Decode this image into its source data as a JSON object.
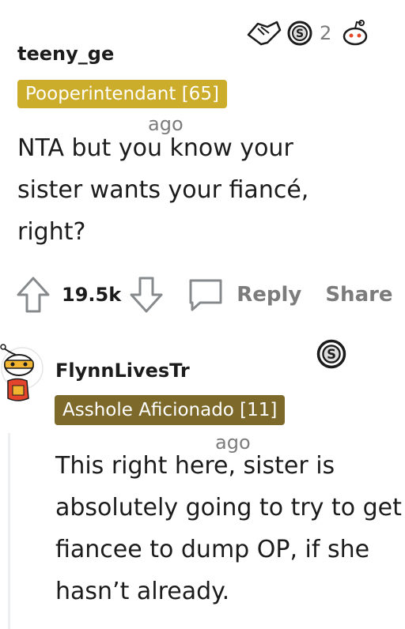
{
  "comment1": {
    "username": "teeny_ge",
    "flair": "Pooperintendant [65]",
    "time": "ago",
    "text": "NTA but you know your sister wants your fiancé, right?",
    "award_count": "2",
    "votes": "19.5k",
    "reply_label": "Reply",
    "share_label": "Share",
    "flair_color": "#ccac2b"
  },
  "comment2": {
    "username": "FlynnLivesTr",
    "flair": "Asshole Aficionado [11]",
    "time": "ago",
    "text": "This right here, sister is absolutely going to try to get fiancee to dump OP, if she hasn’t already.",
    "flair_color": "#7d6a2b"
  },
  "icons": [
    "handshake-award-icon",
    "silver-award-icon",
    "snoo-award-icon",
    "upvote-icon",
    "downvote-icon",
    "comment-bubble-icon",
    "snoo-avatar"
  ]
}
